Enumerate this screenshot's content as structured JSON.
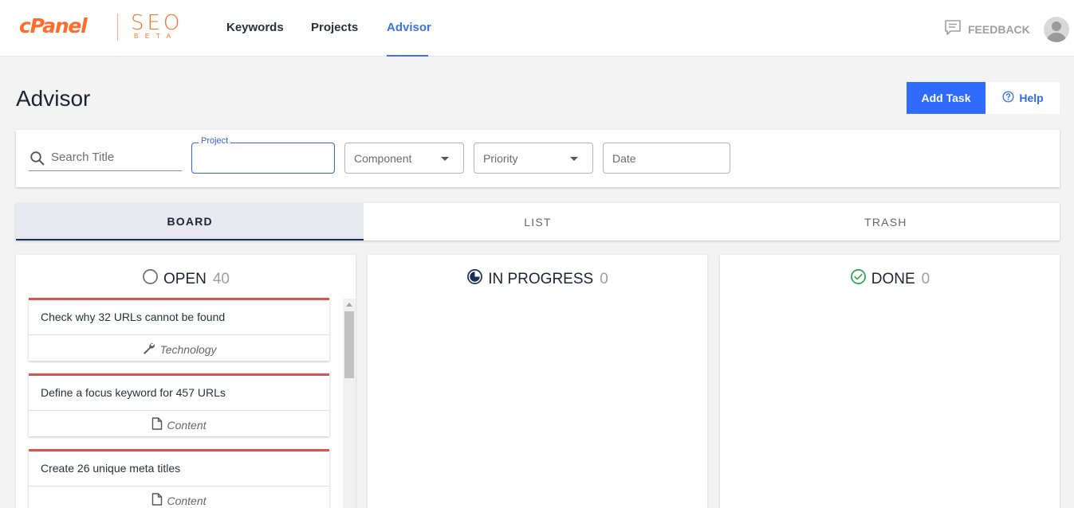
{
  "brand": {
    "name": "cPanel",
    "product": "SEO",
    "tag": "BETA",
    "color": "#ff6c2c"
  },
  "nav": {
    "items": [
      {
        "label": "Keywords",
        "active": false
      },
      {
        "label": "Projects",
        "active": false
      },
      {
        "label": "Advisor",
        "active": true
      }
    ],
    "accent": "#3b73e8"
  },
  "header": {
    "feedback_label": "FEEDBACK",
    "feedback_icon": "feedback-icon",
    "avatar_icon": "user-avatar-icon"
  },
  "page": {
    "title": "Advisor",
    "add_task_label": "Add Task",
    "help_label": "Help",
    "primary_color": "#2f6bff"
  },
  "filters": {
    "search_placeholder": "Search Title",
    "project_label": "Project",
    "project_value": "",
    "component_label": "Component",
    "priority_label": "Priority",
    "date_label": "Date"
  },
  "tabs": [
    {
      "label": "BOARD",
      "active": true
    },
    {
      "label": "LIST",
      "active": false
    },
    {
      "label": "TRASH",
      "active": false
    }
  ],
  "columns": [
    {
      "title": "OPEN",
      "count": "40",
      "icon": "open-circle-icon"
    },
    {
      "title": "IN PROGRESS",
      "count": "0",
      "icon": "in-progress-icon"
    },
    {
      "title": "DONE",
      "count": "0",
      "icon": "done-check-icon"
    }
  ],
  "cards": [
    {
      "title": "Check why 32 URLs cannot be found",
      "category": "Technology",
      "icon": "wrench-icon"
    },
    {
      "title": "Define a focus keyword for 457 URLs",
      "category": "Content",
      "icon": "document-icon"
    },
    {
      "title": "Create 26 unique meta titles",
      "category": "Content",
      "icon": "document-icon"
    }
  ],
  "card_accent": "#d9534f"
}
